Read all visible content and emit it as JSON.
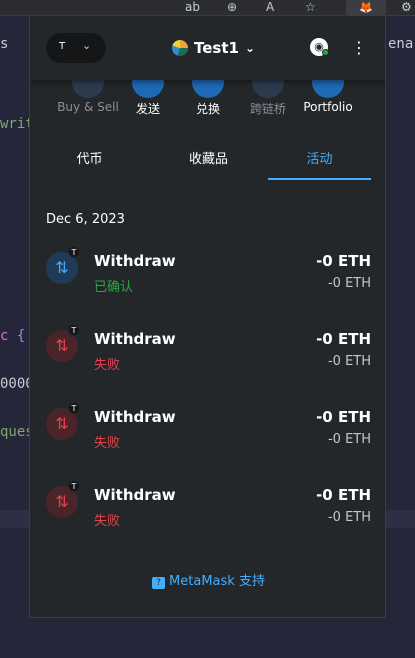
{
  "browser": {
    "icons": [
      "read-aloud-icon",
      "zoom-icon",
      "font-icon",
      "favorite-icon",
      "metamask-fox-icon",
      "settings-icon"
    ],
    "ext_label": "🦊"
  },
  "editor": {
    "left_fragments": [
      "s",
      "writ",
      "c {",
      "0000",
      "ques"
    ],
    "right_fragments": [
      "ena"
    ]
  },
  "header": {
    "network_badge": "T",
    "account_name": "Test1",
    "colors": {
      "background": "#24272a",
      "accent": "#43aefc",
      "success": "#28a745",
      "danger": "#e0434f"
    }
  },
  "actions": [
    {
      "label": "Buy & Sell",
      "muted": true
    },
    {
      "label": "发送",
      "muted": false
    },
    {
      "label": "兑换",
      "muted": false
    },
    {
      "label": "跨链桥",
      "muted": true
    },
    {
      "label": "Portfolio",
      "muted": false
    }
  ],
  "tabs": [
    {
      "label": "代币",
      "active": false
    },
    {
      "label": "收藏品",
      "active": false
    },
    {
      "label": "活动",
      "active": true
    }
  ],
  "activity": {
    "date": "Dec 6, 2023",
    "items": [
      {
        "title": "Withdraw",
        "status": "已确认",
        "status_type": "ok",
        "amount": "-0 ETH",
        "fiat": "-0 ETH",
        "badge": "T"
      },
      {
        "title": "Withdraw",
        "status": "失败",
        "status_type": "fail",
        "amount": "-0 ETH",
        "fiat": "-0 ETH",
        "badge": "T"
      },
      {
        "title": "Withdraw",
        "status": "失败",
        "status_type": "fail",
        "amount": "-0 ETH",
        "fiat": "-0 ETH",
        "badge": "T"
      },
      {
        "title": "Withdraw",
        "status": "失败",
        "status_type": "fail",
        "amount": "-0 ETH",
        "fiat": "-0 ETH",
        "badge": "T"
      }
    ]
  },
  "support": {
    "label": "MetaMask 支持"
  }
}
